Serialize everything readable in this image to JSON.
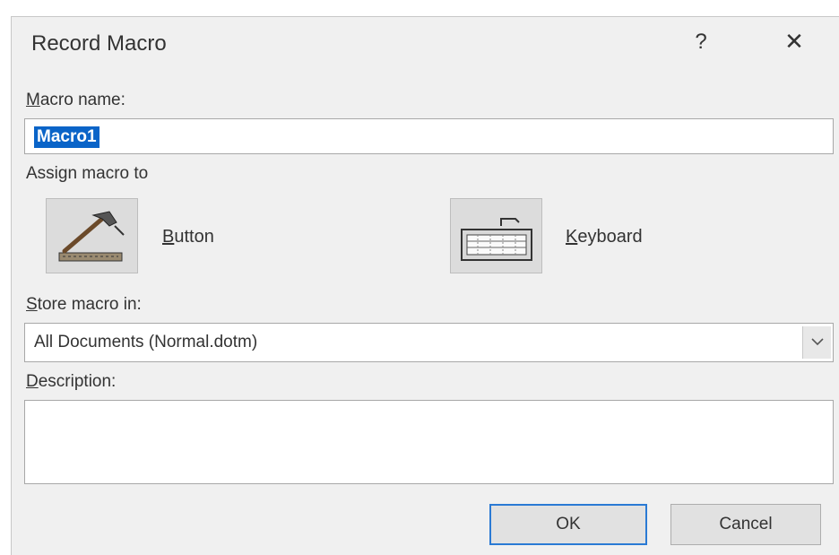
{
  "dialog": {
    "title": "Record Macro",
    "help_glyph": "?",
    "close_glyph": "✕"
  },
  "macro_name": {
    "label_access": "M",
    "label_rest": "acro name:",
    "value": "Macro1"
  },
  "assign": {
    "label": "Assign macro to",
    "button": {
      "label_access": "B",
      "label_rest": "utton",
      "icon": "hammer-icon"
    },
    "keyboard": {
      "label_access": "K",
      "label_rest": "eyboard",
      "icon": "keyboard-icon"
    }
  },
  "store": {
    "label_access": "S",
    "label_rest": "tore macro in:",
    "selected": "All Documents (Normal.dotm)"
  },
  "description": {
    "label_access": "D",
    "label_rest": "escription:",
    "value": ""
  },
  "actions": {
    "ok_label": "OK",
    "cancel_label": "Cancel"
  },
  "colors": {
    "selection": "#0a64c8",
    "ok_border": "#2a7ad4",
    "dialog_bg": "#f0f0f0"
  }
}
